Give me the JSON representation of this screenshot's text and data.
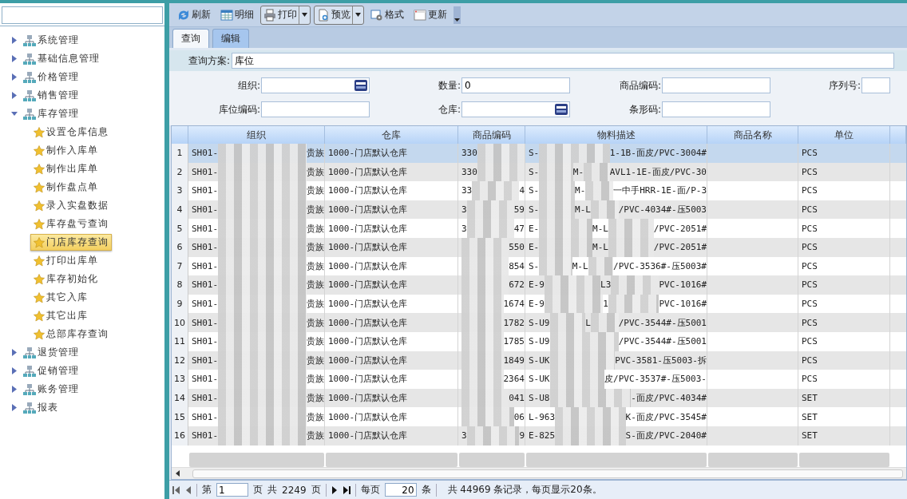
{
  "sidebar": {
    "tree": [
      {
        "label": "系统管理",
        "expanded": false,
        "selected": false
      },
      {
        "label": "基础信息管理",
        "expanded": false,
        "selected": false
      },
      {
        "label": "价格管理",
        "expanded": false,
        "selected": false
      },
      {
        "label": "销售管理",
        "expanded": false,
        "selected": false
      },
      {
        "label": "库存管理",
        "expanded": true,
        "selected": false,
        "children": [
          {
            "label": "设置仓库信息",
            "selected": false
          },
          {
            "label": "制作入库单",
            "selected": false
          },
          {
            "label": "制作出库单",
            "selected": false
          },
          {
            "label": "制作盘点单",
            "selected": false
          },
          {
            "label": "录入实盘数据",
            "selected": false
          },
          {
            "label": "库存盘亏查询",
            "selected": false
          },
          {
            "label": "门店库存查询",
            "selected": true
          },
          {
            "label": "打印出库单",
            "selected": false
          },
          {
            "label": "库存初始化",
            "selected": false
          },
          {
            "label": "其它入库",
            "selected": false
          },
          {
            "label": "其它出库",
            "selected": false
          },
          {
            "label": "总部库存查询",
            "selected": false
          }
        ]
      },
      {
        "label": "退货管理",
        "expanded": false,
        "selected": false
      },
      {
        "label": "促销管理",
        "expanded": false,
        "selected": false
      },
      {
        "label": "账务管理",
        "expanded": false,
        "selected": false
      },
      {
        "label": "报表",
        "expanded": false,
        "selected": false
      }
    ]
  },
  "toolbar": [
    {
      "label": "刷新",
      "kind": "button"
    },
    {
      "label": "明细",
      "kind": "button"
    },
    {
      "label": "打印",
      "kind": "split"
    },
    {
      "label": "预览",
      "kind": "split"
    },
    {
      "label": "格式",
      "kind": "button"
    },
    {
      "label": "更新",
      "kind": "button"
    }
  ],
  "tabs": [
    {
      "label": "查询",
      "selected": true
    },
    {
      "label": "编辑",
      "selected": false
    }
  ],
  "query_plan": {
    "label": "查询方案:",
    "value": "库位"
  },
  "filters": [
    [
      {
        "label": "组织:",
        "picker": true
      },
      {
        "label": "数量:",
        "value": "0",
        "picker": false
      },
      {
        "label": "商品编码:",
        "picker": false
      },
      {
        "label": "序列号:",
        "picker": false
      }
    ],
    [
      {
        "label": "库位编码:",
        "picker": false
      },
      {
        "label": "仓库:",
        "picker": true
      },
      {
        "label": "条形码:",
        "picker": false
      }
    ]
  ],
  "table": {
    "columns": [
      "组织",
      "仓库",
      "商品编码",
      "物料描述",
      "商品名称",
      "单位"
    ],
    "rows": [
      {
        "n": "1",
        "org_start": "SH01-",
        "org_end": "贵族",
        "warehouse": "1000-门店默认仓库",
        "code_start": "330",
        "desc_start": "S-",
        "desc_end": "1-1B-面皮/PVC-3004#",
        "unit": "PCS",
        "selected": true
      },
      {
        "n": "2",
        "org_start": "SH01-",
        "org_end": "贵族",
        "warehouse": "1000-门店默认仓库",
        "code_start": "330",
        "desc_start": "S-",
        "desc_middle": "M-",
        "desc_end": "AVL1-1E-面皮/PVC-30",
        "unit": "PCS",
        "selected": false
      },
      {
        "n": "3",
        "org_start": "SH01-",
        "org_end": "贵族",
        "warehouse": "1000-门店默认仓库",
        "code_start": "33",
        "code_end": "4",
        "desc_start": "S-",
        "desc_middle": "M-",
        "desc_end": "一中手HRR-1E-面/P-3",
        "unit": "PCS",
        "selected": false
      },
      {
        "n": "4",
        "org_start": "SH01-",
        "org_end": "贵族",
        "warehouse": "1000-门店默认仓库",
        "code_start": "3",
        "code_end": "59",
        "desc_start": "S-",
        "desc_middle": "M-L",
        "desc_end": "/PVC-4034#-压5003",
        "unit": "PCS",
        "selected": false
      },
      {
        "n": "5",
        "org_start": "SH01-",
        "org_end": "贵族",
        "warehouse": "1000-门店默认仓库",
        "code_start": "3",
        "code_end": "47",
        "desc_start": "E-",
        "desc_middle": "M-L",
        "desc_end": "/PVC-2051#",
        "unit": "PCS",
        "selected": false
      },
      {
        "n": "6",
        "org_start": "SH01-",
        "org_end": "贵族",
        "warehouse": "1000-门店默认仓库",
        "code_end": "550",
        "desc_start": "E-",
        "desc_middle": "M-L",
        "desc_end": "/PVC-2051#",
        "unit": "PCS",
        "selected": false
      },
      {
        "n": "7",
        "org_start": "SH01-",
        "org_end": "贵族",
        "warehouse": "1000-门店默认仓库",
        "code_end": "854",
        "desc_start": "S-",
        "desc_middle": "M-L",
        "desc_end": "/PVC-3536#-压5003#",
        "unit": "PCS",
        "selected": false
      },
      {
        "n": "8",
        "org_start": "SH01-",
        "org_end": "贵族",
        "warehouse": "1000-门店默认仓库",
        "code_end": "672",
        "desc_start": "E-9",
        "desc_middle": "L3",
        "desc_end": "PVC-1016#",
        "unit": "PCS",
        "selected": false
      },
      {
        "n": "9",
        "org_start": "SH01-",
        "org_end": "贵族",
        "warehouse": "1000-门店默认仓库",
        "code_end": "1674",
        "desc_start": "E-9",
        "desc_middle": "1",
        "desc_end": "PVC-1016#",
        "unit": "PCS",
        "selected": false
      },
      {
        "n": "10",
        "org_start": "SH01-",
        "org_end": "贵族",
        "warehouse": "1000-门店默认仓库",
        "code_end": "1782",
        "desc_start": "S-U9",
        "desc_middle": "L",
        "desc_end": "/PVC-3544#-压5001",
        "unit": "PCS",
        "selected": false
      },
      {
        "n": "11",
        "org_start": "SH01-",
        "org_end": "贵族",
        "warehouse": "1000-门店默认仓库",
        "code_end": "1785",
        "desc_start": "S-U9",
        "desc_end": "/PVC-3544#-压5001",
        "unit": "PCS",
        "selected": false
      },
      {
        "n": "12",
        "org_start": "SH01-",
        "org_end": "贵族",
        "warehouse": "1000-门店默认仓库",
        "code_end": "1849",
        "desc_start": "S-UK",
        "desc_end": "PVC-3581-压5003-拆",
        "unit": "PCS",
        "selected": false
      },
      {
        "n": "13",
        "org_start": "SH01-",
        "org_end": "贵族",
        "warehouse": "1000-门店默认仓库",
        "code_end": "2364",
        "desc_start": "S-UK",
        "desc_end": "皮/PVC-3537#-压5003-",
        "unit": "PCS",
        "selected": false
      },
      {
        "n": "14",
        "org_start": "SH01-",
        "org_end": "贵族",
        "warehouse": "1000-门店默认仓库",
        "code_end": "041",
        "desc_start": "S-U8",
        "desc_end": "-面皮/PVC-4034#",
        "unit": "SET",
        "selected": false
      },
      {
        "n": "15",
        "org_start": "SH01-",
        "org_end": "贵族",
        "warehouse": "1000-门店默认仓库",
        "code_end": "06",
        "desc_start": "L-963",
        "desc_end": "K-面皮/PVC-3545#",
        "unit": "SET",
        "selected": false
      },
      {
        "n": "16",
        "org_start": "SH01-",
        "org_end": "贵族",
        "warehouse": "1000-门店默认仓库",
        "code_start": "3",
        "code_end": "9",
        "desc_start": "E-825",
        "desc_end": "S-面皮/PVC-2040#",
        "unit": "SET",
        "selected": false
      }
    ]
  },
  "pager": {
    "page_prefix": "第",
    "page": "1",
    "page_suffix": "页",
    "total_prefix": "共",
    "total_pages": "2249",
    "total_suffix": "页",
    "per_page_label": "每页",
    "per_page": "20",
    "per_page_unit": "条",
    "summary": "共 44969 条记录，每页显示20条。"
  }
}
